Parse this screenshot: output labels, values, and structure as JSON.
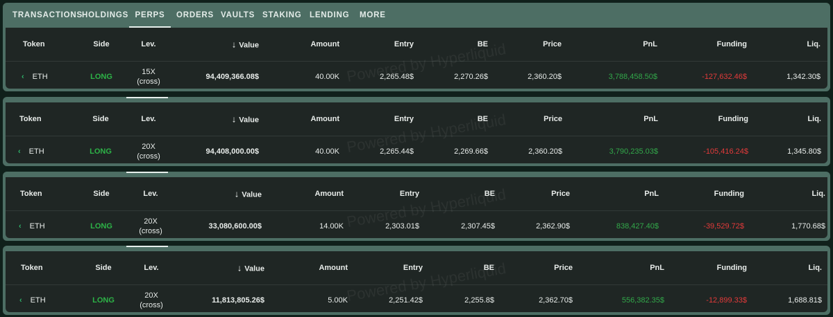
{
  "tabs": [
    "TRANSACTIONS",
    "HOLDINGS",
    "PERPS",
    "ORDERS",
    "VAULTS",
    "STAKING",
    "LENDING",
    "MORE"
  ],
  "active_tab": "PERPS",
  "columns": {
    "token": "Token",
    "side": "Side",
    "lev": "Lev.",
    "value": "Value",
    "amount": "Amount",
    "entry": "Entry",
    "be": "BE",
    "price": "Price",
    "pnl": "PnL",
    "funding": "Funding",
    "liq": "Liq."
  },
  "sort_icon": "arrow-down-icon",
  "watermark": "Powered by Hyperliquid",
  "colors": {
    "long": "#2db347",
    "pnl_positive": "#32a84a",
    "funding_negative": "#e33a3a",
    "panel": "#4d6e64"
  },
  "positions": [
    {
      "token": "ETH",
      "side": "LONG",
      "lev": "15X",
      "lev_mode": "(cross)",
      "value": "94,409,366.08$",
      "amount": "40.00K",
      "entry": "2,265.48$",
      "be": "2,270.26$",
      "price": "2,360.20$",
      "pnl": "3,788,458.50$",
      "funding": "-127,632.46$",
      "liq": "1,342.30$"
    },
    {
      "token": "ETH",
      "side": "LONG",
      "lev": "20X",
      "lev_mode": "(cross)",
      "value": "94,408,000.00$",
      "amount": "40.00K",
      "entry": "2,265.44$",
      "be": "2,269.66$",
      "price": "2,360.20$",
      "pnl": "3,790,235.03$",
      "funding": "-105,416.24$",
      "liq": "1,345.80$"
    },
    {
      "token": "ETH",
      "side": "LONG",
      "lev": "20X",
      "lev_mode": "(cross)",
      "value": "33,080,600.00$",
      "amount": "14.00K",
      "entry": "2,303.01$",
      "be": "2,307.45$",
      "price": "2,362.90$",
      "pnl": "838,427.40$",
      "funding": "-39,529.72$",
      "liq": "1,770.68$"
    },
    {
      "token": "ETH",
      "side": "LONG",
      "lev": "20X",
      "lev_mode": "(cross)",
      "value": "11,813,805.26$",
      "amount": "5.00K",
      "entry": "2,251.42$",
      "be": "2,255.8$",
      "price": "2,362.70$",
      "pnl": "556,382.35$",
      "funding": "-12,899.33$",
      "liq": "1,688.81$"
    }
  ]
}
